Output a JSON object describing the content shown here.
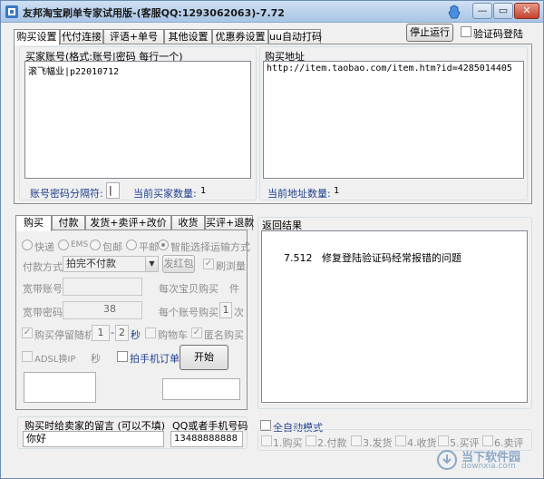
{
  "window": {
    "title": "友邦淘宝刷单专家试用版-(客服QQ:1293062063)-7.72",
    "min_label": "—",
    "max_label": "▭",
    "close_label": "✕"
  },
  "top_tabs": [
    "购买设置",
    "代付连接",
    "评语+单号",
    "其他设置",
    "优惠券设置",
    "uu自动打码"
  ],
  "top_actions": {
    "stop_label": "停止运行",
    "captcha_login_label": "验证码登陆"
  },
  "buyer_group": {
    "title": "买家账号(格式:账号|密码 每行一个)",
    "content": "滚飞幅业|p22010712",
    "separator_label": "账号密码分隔符:",
    "separator_value": "|",
    "count_label": "当前买家数量:",
    "count_value": "1"
  },
  "address_group": {
    "title": "购买地址",
    "content": "http://item.taobao.com/item.htm?id=4285014405",
    "count_label": "当前地址数量:",
    "count_value": "1"
  },
  "lower_tabs": [
    "购买",
    "付款",
    "发货+卖评+改价",
    "收货",
    "买评+退款"
  ],
  "buy_panel": {
    "radios": [
      "快递",
      "EMS",
      "包邮",
      "平邮",
      "智能选择运输方式"
    ],
    "pay_method_label": "付款方式",
    "pay_method_value": "拍完不付款",
    "red_packet_button": "发红包",
    "refresh_traffic_label": "刷浏量",
    "broadband_account_label": "宽带账号",
    "per_item_label": "每次宝贝购买",
    "per_item_unit": "件",
    "broadband_password_label": "宽带密码",
    "broadband_password_value": "38",
    "per_account_label": "每个账号购买",
    "per_account_value": "1",
    "per_account_unit": "次",
    "random_pause_label": "购买停留随机",
    "random_from": "1",
    "random_to": "2",
    "random_unit": "秒",
    "cart_label": "购物车",
    "anonymous_label": "匿名购买",
    "adsl_label": "ADSL换IP",
    "adsl_unit": "秒",
    "phone_order_label": "拍手机订单",
    "start_button": "开始"
  },
  "result_group": {
    "title": "返回结果",
    "content": "7.512   修复登陆验证码经常报错的问题"
  },
  "bottom": {
    "message_label": "购买时给卖家的留言 (可以不填)",
    "message_value": "你好",
    "phone_label": "QQ或者手机号码",
    "phone_value": "13488888888",
    "auto_mode_label": "全自动模式",
    "steps": [
      "1.购买",
      "2.付款",
      "3.发货",
      "4.收货",
      "5.买评",
      "6.卖评"
    ]
  },
  "watermark": {
    "line1": "当下软件园",
    "line2": "downxia.com"
  }
}
